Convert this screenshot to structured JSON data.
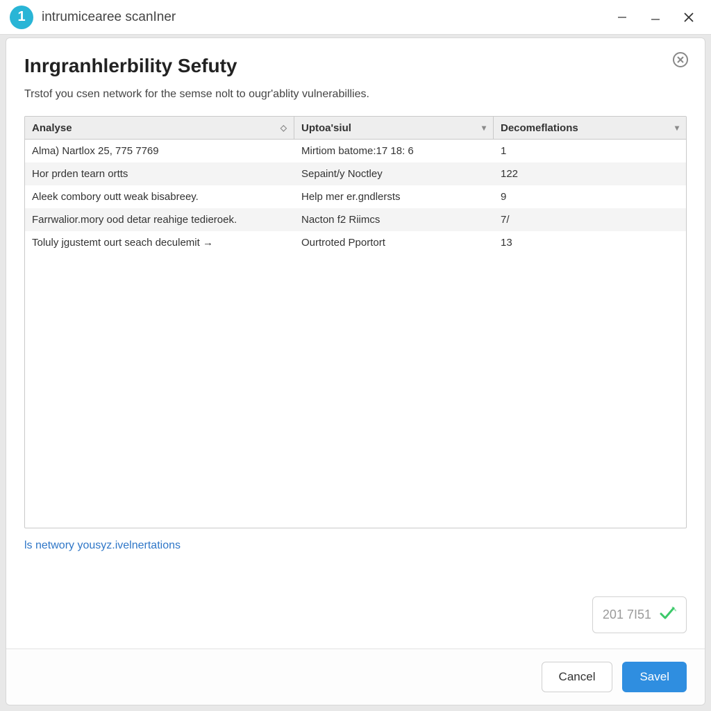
{
  "titlebar": {
    "icon_glyph": "1",
    "title": "intrumicearee scanIner"
  },
  "dialog": {
    "title": "Inrgranhlerbility Sefuty",
    "description": "Trstof you csen network for the semse nolt to ougr'ablity vulnerabillies.",
    "close_icon": "⊗"
  },
  "table": {
    "columns": [
      {
        "label": "Analyse"
      },
      {
        "label": "Uptoa'siul"
      },
      {
        "label": "Decomeflations"
      }
    ],
    "rows": [
      {
        "c1": "Alma) Nartlox 25, 775 7769",
        "c2": "Mirtiom batome:17 18: 6",
        "c3": "1"
      },
      {
        "c1": "Hor prden tearn ortts",
        "c2": "Sepaint/y Noctley",
        "c3": "122"
      },
      {
        "c1": "Aleek combory outt weak bisabreey.",
        "c2": "Help mer er.gndlersts",
        "c3": "9"
      },
      {
        "c1": "Farrwalior.mory ood detar reahige tedieroek.",
        "c2": "Nacton f2 Riimcs",
        "c3": "7/"
      },
      {
        "c1": "Toluly jgustemt ourt seach deculemit →",
        "c2": "Ourtroted Pportort",
        "c3": "13"
      }
    ]
  },
  "link": {
    "label": "ls networy yousyz.ivelnertations"
  },
  "status": {
    "value": "201 7I51"
  },
  "footer": {
    "cancel": "Cancel",
    "save": "Savel"
  }
}
